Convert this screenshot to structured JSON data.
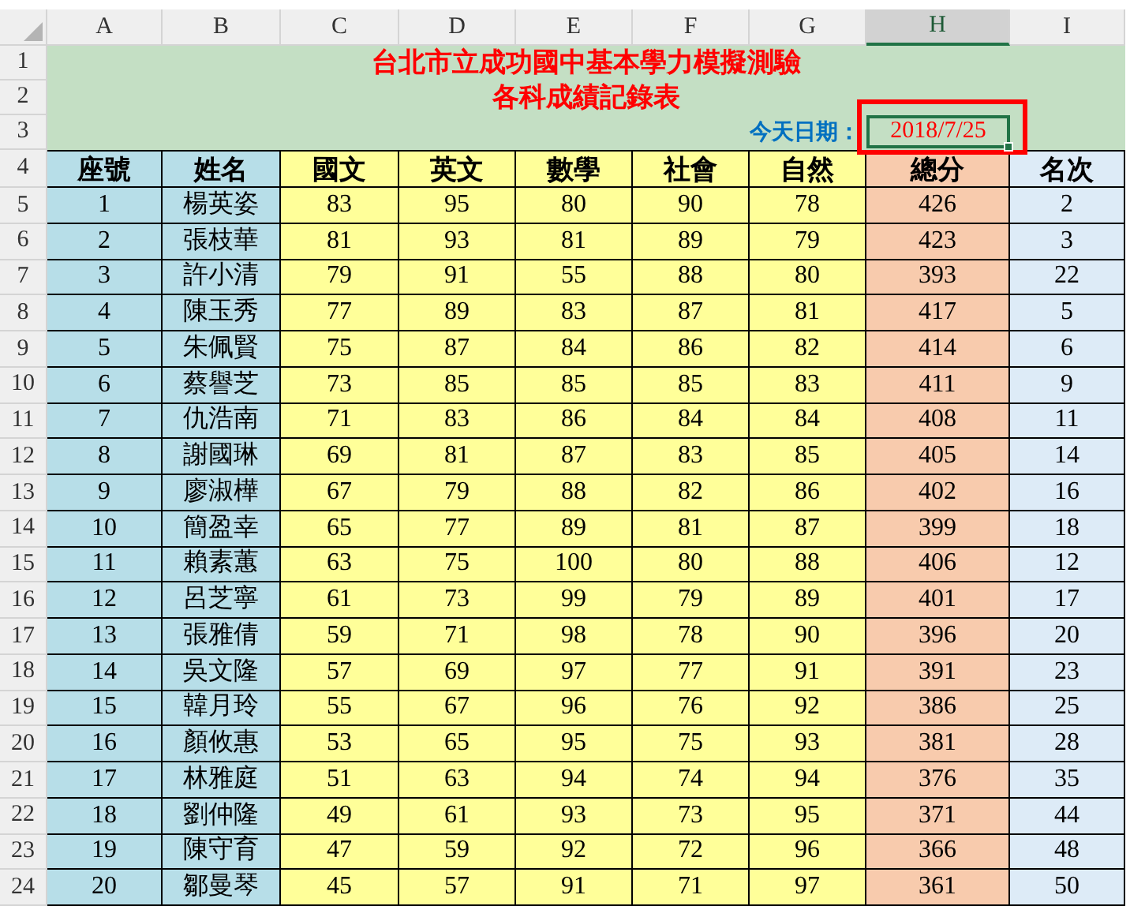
{
  "columns": [
    {
      "label": "A",
      "selected": false
    },
    {
      "label": "B",
      "selected": false
    },
    {
      "label": "C",
      "selected": false
    },
    {
      "label": "D",
      "selected": false
    },
    {
      "label": "E",
      "selected": false
    },
    {
      "label": "F",
      "selected": false
    },
    {
      "label": "G",
      "selected": false
    },
    {
      "label": "H",
      "selected": true
    },
    {
      "label": "I",
      "selected": false
    }
  ],
  "title_rows": [
    {
      "number": "1",
      "text": "台北市立成功國中基本學力模擬測驗"
    },
    {
      "number": "2",
      "text": "各科成績記錄表"
    }
  ],
  "date_row": {
    "number": "3",
    "label": "今天日期：",
    "value": "2018/7/25",
    "selected": true
  },
  "header_row": {
    "number": "4",
    "cells": [
      "座號",
      "姓名",
      "國文",
      "英文",
      "數學",
      "社會",
      "自然",
      "總分",
      "名次"
    ]
  },
  "rows": [
    {
      "number": "5",
      "cells": [
        "1",
        "楊英姿",
        "83",
        "95",
        "80",
        "90",
        "78",
        "426",
        "2"
      ]
    },
    {
      "number": "6",
      "cells": [
        "2",
        "張枝華",
        "81",
        "93",
        "81",
        "89",
        "79",
        "423",
        "3"
      ]
    },
    {
      "number": "7",
      "cells": [
        "3",
        "許小清",
        "79",
        "91",
        "55",
        "88",
        "80",
        "393",
        "22"
      ]
    },
    {
      "number": "8",
      "cells": [
        "4",
        "陳玉秀",
        "77",
        "89",
        "83",
        "87",
        "81",
        "417",
        "5"
      ]
    },
    {
      "number": "9",
      "cells": [
        "5",
        "朱佩賢",
        "75",
        "87",
        "84",
        "86",
        "82",
        "414",
        "6"
      ]
    },
    {
      "number": "10",
      "cells": [
        "6",
        "蔡譽芝",
        "73",
        "85",
        "85",
        "85",
        "83",
        "411",
        "9"
      ]
    },
    {
      "number": "11",
      "cells": [
        "7",
        "仇浩南",
        "71",
        "83",
        "86",
        "84",
        "84",
        "408",
        "11"
      ]
    },
    {
      "number": "12",
      "cells": [
        "8",
        "謝國琳",
        "69",
        "81",
        "87",
        "83",
        "85",
        "405",
        "14"
      ]
    },
    {
      "number": "13",
      "cells": [
        "9",
        "廖淑樺",
        "67",
        "79",
        "88",
        "82",
        "86",
        "402",
        "16"
      ]
    },
    {
      "number": "14",
      "cells": [
        "10",
        "簡盈幸",
        "65",
        "77",
        "89",
        "81",
        "87",
        "399",
        "18"
      ]
    },
    {
      "number": "15",
      "cells": [
        "11",
        "賴素蕙",
        "63",
        "75",
        "100",
        "80",
        "88",
        "406",
        "12"
      ]
    },
    {
      "number": "16",
      "cells": [
        "12",
        "呂芝寧",
        "61",
        "73",
        "99",
        "79",
        "89",
        "401",
        "17"
      ]
    },
    {
      "number": "17",
      "cells": [
        "13",
        "張雅倩",
        "59",
        "71",
        "98",
        "78",
        "90",
        "396",
        "20"
      ]
    },
    {
      "number": "18",
      "cells": [
        "14",
        "吳文隆",
        "57",
        "69",
        "97",
        "77",
        "91",
        "391",
        "23"
      ]
    },
    {
      "number": "19",
      "cells": [
        "15",
        "韓月玲",
        "55",
        "67",
        "96",
        "76",
        "92",
        "386",
        "25"
      ]
    },
    {
      "number": "20",
      "cells": [
        "16",
        "顏攸惠",
        "53",
        "65",
        "95",
        "75",
        "93",
        "381",
        "28"
      ]
    },
    {
      "number": "21",
      "cells": [
        "17",
        "林雅庭",
        "51",
        "63",
        "94",
        "74",
        "94",
        "376",
        "35"
      ]
    },
    {
      "number": "22",
      "cells": [
        "18",
        "劉仲隆",
        "49",
        "61",
        "93",
        "73",
        "95",
        "371",
        "44"
      ]
    },
    {
      "number": "23",
      "cells": [
        "19",
        "陳守育",
        "47",
        "59",
        "92",
        "72",
        "96",
        "366",
        "48"
      ]
    },
    {
      "number": "24",
      "cells": [
        "20",
        "鄒曼琴",
        "45",
        "57",
        "91",
        "71",
        "97",
        "361",
        "50"
      ]
    }
  ]
}
